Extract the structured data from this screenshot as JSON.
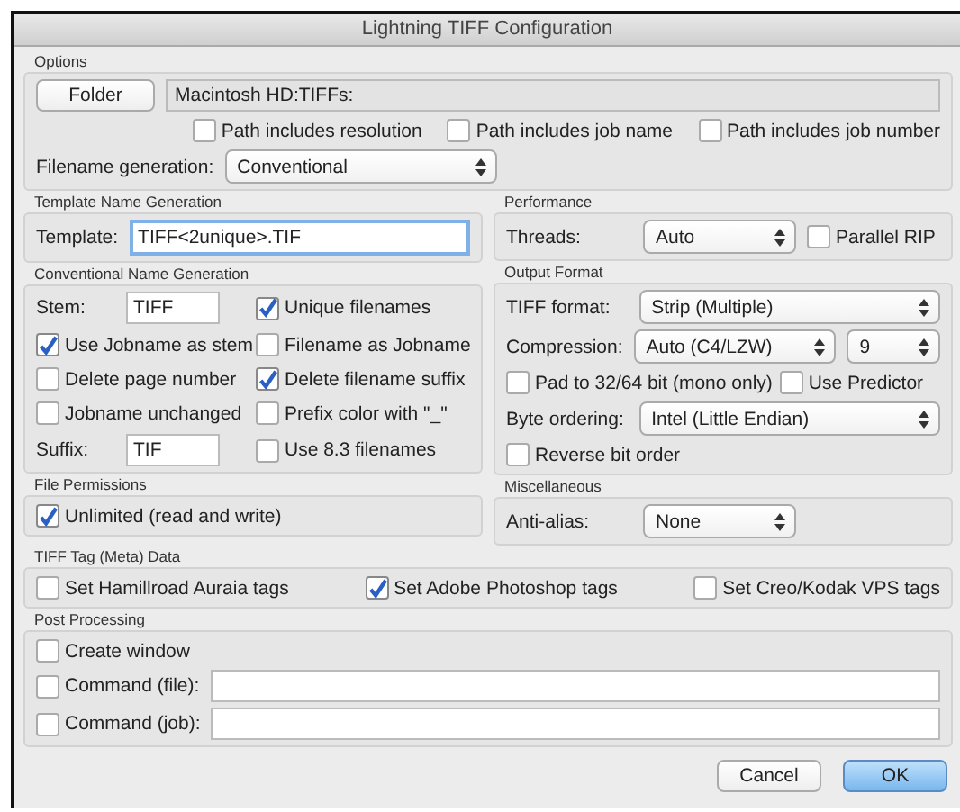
{
  "window": {
    "title": "Lightning TIFF Configuration"
  },
  "options": {
    "title": "Options",
    "folder_button": "Folder",
    "path": "Macintosh HD:TIFFs:",
    "checkboxes": [
      {
        "label": "Path includes resolution",
        "checked": false
      },
      {
        "label": "Path includes job name",
        "checked": false
      },
      {
        "label": "Path includes job number",
        "checked": false
      }
    ],
    "filename_generation": {
      "label": "Filename generation:",
      "value": "Conventional"
    }
  },
  "template_name_generation": {
    "title": "Template Name Generation",
    "label": "Template:",
    "value": "TIFF<2unique>.TIF"
  },
  "conventional_name_generation": {
    "title": "Conventional Name Generation",
    "items": [
      {
        "kind": "field",
        "label": "Stem:",
        "value": "TIFF"
      },
      {
        "kind": "checkbox",
        "label": "Unique filenames",
        "checked": true
      },
      {
        "kind": "checkbox",
        "label": "Use Jobname as stem",
        "checked": true
      },
      {
        "kind": "checkbox",
        "label": "Filename as Jobname",
        "checked": false
      },
      {
        "kind": "checkbox",
        "label": "Delete page number",
        "checked": false
      },
      {
        "kind": "checkbox",
        "label": "Delete filename suffix",
        "checked": true
      },
      {
        "kind": "checkbox",
        "label": "Jobname unchanged",
        "checked": false
      },
      {
        "kind": "checkbox",
        "label": "Prefix color with \"_\"",
        "checked": false
      },
      {
        "kind": "field",
        "label": "Suffix:",
        "value": "TIF"
      },
      {
        "kind": "checkbox",
        "label": "Use 8.3 filenames",
        "checked": false
      }
    ]
  },
  "file_permissions": {
    "title": "File Permissions",
    "checkbox": {
      "label": "Unlimited (read and write)",
      "checked": true
    }
  },
  "performance": {
    "title": "Performance",
    "threads": {
      "label": "Threads:",
      "value": "Auto"
    },
    "parallel_rip": {
      "label": "Parallel RIP",
      "checked": false
    }
  },
  "output_format": {
    "title": "Output Format",
    "tiff_format": {
      "label": "TIFF format:",
      "value": "Strip (Multiple)"
    },
    "compression": {
      "label": "Compression:",
      "value": "Auto (C4/LZW)",
      "level_value": "9"
    },
    "checkboxes": [
      {
        "label": "Pad to 32/64 bit (mono only)",
        "checked": false
      },
      {
        "label": "Use Predictor",
        "checked": false
      }
    ],
    "byte_ordering": {
      "label": "Byte ordering:",
      "value": "Intel (Little Endian)"
    },
    "reverse_bit_order": {
      "label": "Reverse bit order",
      "checked": false
    }
  },
  "miscellaneous": {
    "title": "Miscellaneous",
    "anti_alias": {
      "label": "Anti-alias:",
      "value": "None"
    }
  },
  "tiff_tag_data": {
    "title": "TIFF Tag (Meta) Data",
    "checkboxes": [
      {
        "label": "Set Hamillroad Auraia tags",
        "checked": false
      },
      {
        "label": "Set Adobe Photoshop tags",
        "checked": true
      },
      {
        "label": "Set Creo/Kodak VPS tags",
        "checked": false
      }
    ]
  },
  "post_processing": {
    "title": "Post Processing",
    "create_window": {
      "label": "Create window",
      "checked": false
    },
    "commands": [
      {
        "label": "Command (file):",
        "checked": false
      },
      {
        "label": "Command (job):",
        "checked": false
      }
    ]
  },
  "buttons": [
    {
      "label": "Cancel",
      "default": false
    },
    {
      "label": "OK",
      "default": true
    }
  ]
}
